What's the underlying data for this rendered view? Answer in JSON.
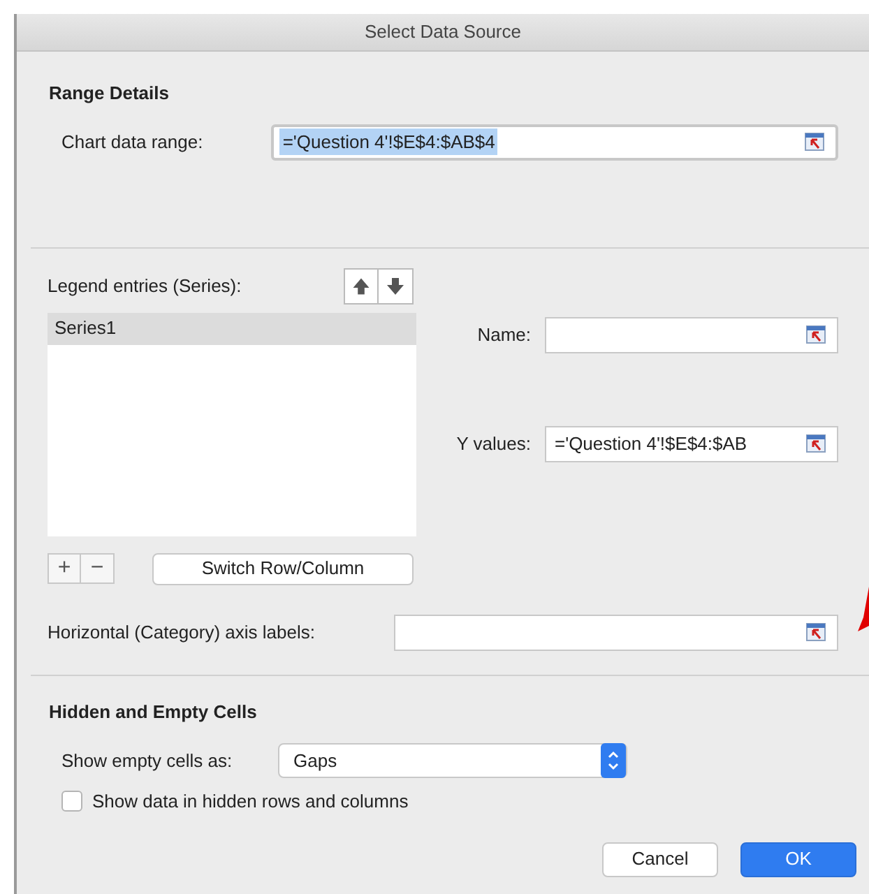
{
  "window": {
    "title": "Select Data Source"
  },
  "range_details": {
    "heading": "Range Details",
    "label": "Chart data range:",
    "value": "='Question 4'!$E$4:$AB$4",
    "text_selected": true
  },
  "legend": {
    "label": "Legend entries (Series):",
    "series": [
      {
        "name": "Series1",
        "selected": true
      }
    ],
    "switch_button": "Switch Row/Column",
    "add_button": "+",
    "remove_button": "−"
  },
  "series_fields": [
    {
      "label": "Name:"
    },
    {
      "label": "Y values:",
      "value": "='Question 4'!$E$4:$AB"
    }
  ],
  "axis_labels": {
    "label": "Horizontal (Category) axis labels:"
  },
  "hidden_empty": {
    "heading": "Hidden and Empty Cells",
    "label": "Show empty cells as:",
    "value": "Gaps",
    "checkbox": {
      "label": "Show data in hidden rows and columns",
      "checked": false
    }
  },
  "buttons": [
    {
      "label": "Cancel",
      "kind": "normal"
    },
    {
      "label": "OK",
      "kind": "default"
    }
  ]
}
